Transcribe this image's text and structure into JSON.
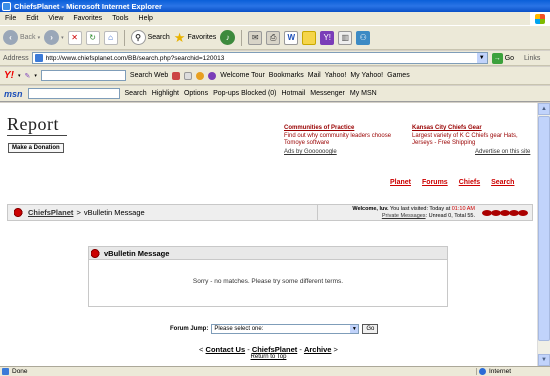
{
  "window": {
    "title": "ChiefsPlanet - Microsoft Internet Explorer"
  },
  "menu": [
    "File",
    "Edit",
    "View",
    "Favorites",
    "Tools",
    "Help"
  ],
  "toolbar": {
    "back": "Back",
    "search": "Search",
    "favorites": "Favorites"
  },
  "address": {
    "label": "Address",
    "url": "http://www.chiefsplanet.com/BB/search.php?searchid=120013",
    "go": "Go",
    "links": "Links"
  },
  "yahoo_bar": {
    "search_web": "Search Web",
    "welcome_tour": "Welcome Tour",
    "bookmarks": "Bookmarks",
    "mail": "Mail",
    "yahoo": "Yahoo!",
    "my_yahoo": "My Yahoo!",
    "games": "Games"
  },
  "msn_bar": {
    "search": "Search",
    "highlight": "Highlight",
    "options": "Options",
    "popups": "Pop-ups Blocked (0)",
    "hotmail": "Hotmail",
    "messenger": "Messenger",
    "my_msn": "My MSN"
  },
  "page": {
    "logo": "Report",
    "donate": "Make a Donation",
    "ad1": {
      "title": "Communities of Practice",
      "line1": "Find out why community leaders choose",
      "line2": "Tomoye software"
    },
    "ad2": {
      "title": "Kansas City Chiefs Gear",
      "line1": "Largest variety of K C Chiefs gear Hats,",
      "line2": "Jerseys - Free Shipping"
    },
    "ads_by": "Ads by Goooooogle",
    "advertise": "Advertise on this site",
    "nav": [
      "Planet",
      "Forums",
      "Chiefs",
      "Search"
    ],
    "crumb": {
      "home": "ChiefsPlanet",
      "sep": ">",
      "current": "vBulletin Message"
    },
    "welcome": {
      "greeting": "Welcome, luv.",
      "last_visited": "You last visited: Today at",
      "time": "01:10 AM",
      "pm_link": "Private Messages",
      "pm_status": ": Unread 0, Total 55."
    },
    "message": {
      "title": "vBulletin Message",
      "body": "Sorry - no matches. Please try some different terms."
    },
    "forum_jump": {
      "label": "Forum Jump:",
      "selected": "Please select one:",
      "go": "Go"
    },
    "bottom": {
      "open": "<",
      "contact": "Contact Us",
      "dash1": "-",
      "home": "ChiefsPlanet",
      "dash2": "-",
      "archive": "Archive",
      "close": ">"
    },
    "return_top": "Return to Top"
  },
  "status": {
    "text": "Done",
    "zone": "Internet"
  }
}
